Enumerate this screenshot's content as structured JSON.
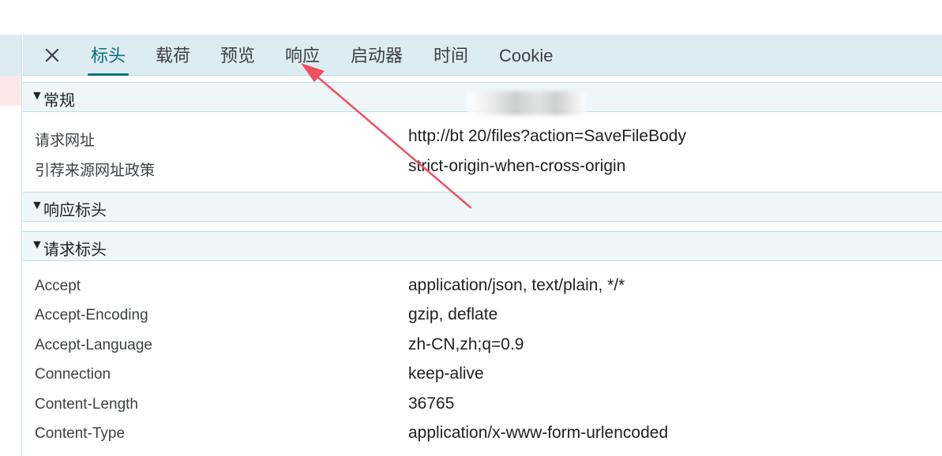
{
  "tabs": {
    "close": "✕",
    "items": [
      "标头",
      "载荷",
      "预览",
      "响应",
      "启动器",
      "时间",
      "Cookie"
    ],
    "active": "标头"
  },
  "general": {
    "title": "常规",
    "rows": [
      {
        "key": "请求网址",
        "value": "http://bt              20/files?action=SaveFileBody"
      },
      {
        "key": "引荐来源网址政策",
        "value": "strict-origin-when-cross-origin"
      }
    ]
  },
  "response_headers": {
    "title": "响应标头"
  },
  "request_headers": {
    "title": "请求标头",
    "rows": [
      {
        "key": "Accept",
        "value": "application/json, text/plain, */*"
      },
      {
        "key": "Accept-Encoding",
        "value": "gzip, deflate"
      },
      {
        "key": "Accept-Language",
        "value": "zh-CN,zh;q=0.9"
      },
      {
        "key": "Connection",
        "value": "keep-alive"
      },
      {
        "key": "Content-Length",
        "value": "36765"
      },
      {
        "key": "Content-Type",
        "value": "application/x-www-form-urlencoded"
      }
    ]
  },
  "colors": {
    "accent": "#0b6e7f",
    "tabbar_bg": "#dcecf2",
    "section_bg": "#eef6f8",
    "annotation_arrow": "#f04e5e"
  },
  "icons": {
    "close": "close-icon",
    "collapse": "triangle-down-icon"
  }
}
